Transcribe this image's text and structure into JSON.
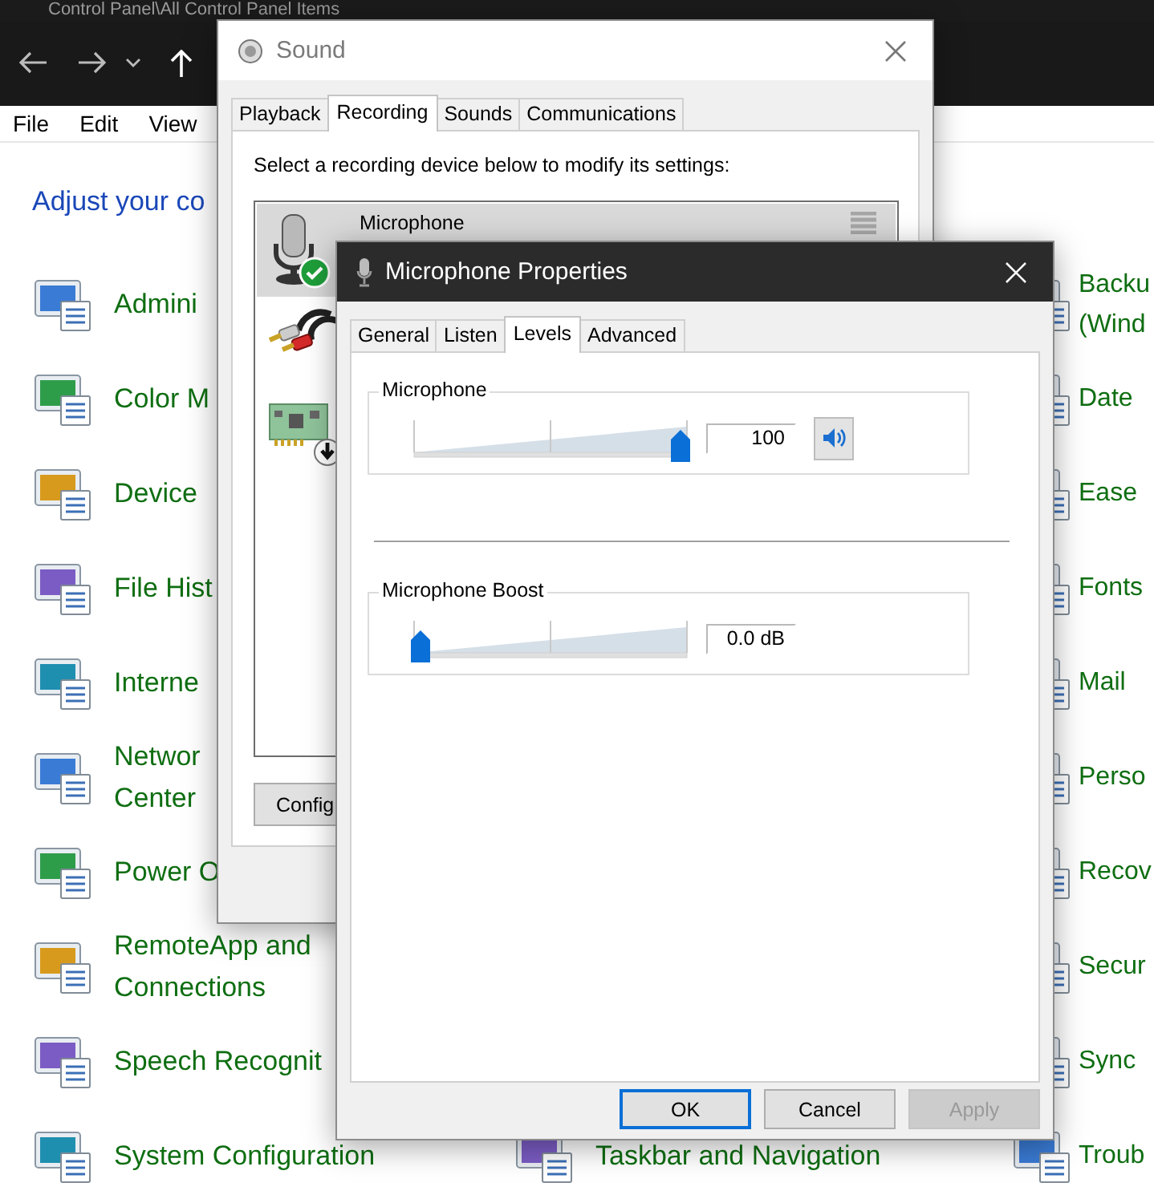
{
  "explorer": {
    "title": "Control Panel\\All Control Panel Items",
    "menu": [
      "File",
      "Edit",
      "View"
    ],
    "heading": "Adjust your co",
    "columns": [
      {
        "items": [
          "Admini",
          "Color M",
          "Device",
          "File Hist",
          "Interne",
          "Networ\nCenter",
          "Power O",
          "RemoteApp and\nConnections",
          "Speech Recognit",
          "System Configuration"
        ]
      },
      {
        "items": [
          "Taskbar and Navigation"
        ]
      },
      {
        "items": [
          "Backu\n(Wind",
          "Date",
          "Ease",
          "Fonts",
          "Mail",
          "Perso",
          "Recov",
          "Secur",
          "Sync",
          "Troub"
        ]
      }
    ]
  },
  "sound": {
    "title": "Sound",
    "tabs": [
      {
        "label": "Playback",
        "selected": false
      },
      {
        "label": "Recording",
        "selected": true
      },
      {
        "label": "Sounds",
        "selected": false
      },
      {
        "label": "Communications",
        "selected": false
      }
    ],
    "instruction": "Select a recording device below to modify its settings:",
    "devices": [
      {
        "kind": "microphone",
        "name": "Microphone",
        "selected": true
      },
      {
        "kind": "line-in",
        "selected": false
      },
      {
        "kind": "card",
        "selected": false
      }
    ],
    "button": "Config"
  },
  "properties": {
    "title": "Microphone Properties",
    "tabs": [
      {
        "label": "General",
        "selected": false
      },
      {
        "label": "Listen",
        "selected": false
      },
      {
        "label": "Levels",
        "selected": true
      },
      {
        "label": "Advanced",
        "selected": false
      }
    ],
    "groups": [
      {
        "kind": "volume",
        "label": "Microphone",
        "level": 1,
        "value": "100",
        "muted": false
      },
      {
        "kind": "boost",
        "label": "Microphone Boost",
        "level": 0,
        "value": "0.0 dB"
      }
    ],
    "buttons": [
      {
        "label": "OK",
        "default": true,
        "disabled": false
      },
      {
        "label": "Cancel",
        "default": false,
        "disabled": false
      },
      {
        "label": "Apply",
        "default": false,
        "disabled": true
      }
    ]
  }
}
